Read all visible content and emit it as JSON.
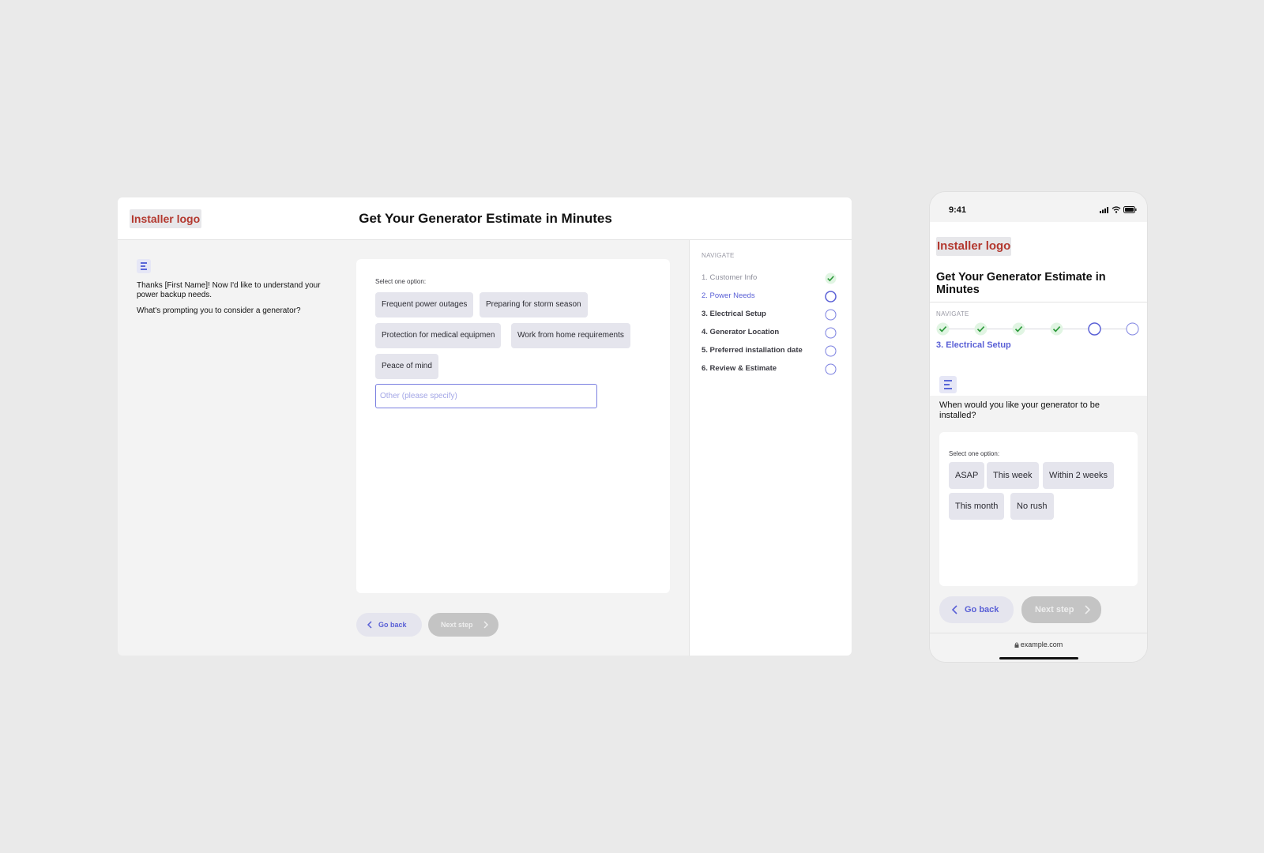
{
  "desktop": {
    "logo": "Installer logo",
    "title": "Get Your Generator Estimate in Minutes",
    "message": "Thanks [First Name]! Now I'd like to understand your power backup needs.",
    "question": "What's prompting you to consider a generator?",
    "select_label": "Select one option:",
    "options": [
      "Frequent power outages",
      "Preparing for storm season",
      "Protection for medical equipmen",
      "Work from home requirements",
      "Peace of mind"
    ],
    "other_placeholder": "Other (please specify)",
    "back_label": "Go back",
    "next_label": "Next step",
    "nav": {
      "heading": "NAVIGATE",
      "items": [
        {
          "label": "1. Customer Info",
          "status": "done"
        },
        {
          "label": "2. Power Needs",
          "status": "current"
        },
        {
          "label": "3. Electrical Setup",
          "status": "todo"
        },
        {
          "label": "4. Generator Location",
          "status": "todo"
        },
        {
          "label": "5. Preferred installation date",
          "status": "todo"
        },
        {
          "label": "6. Review & Estimate",
          "status": "todo"
        }
      ]
    }
  },
  "mobile": {
    "time": "9:41",
    "logo": "Installer logo",
    "title": "Get Your Generator Estimate in Minutes",
    "nav_heading": "NAVIGATE",
    "steps": [
      "done",
      "done",
      "done",
      "done",
      "current",
      "todo"
    ],
    "current_step_label": "3. Electrical Setup",
    "question": "When would you like your generator to be installed?",
    "select_label": "Select one option:",
    "options": [
      "ASAP",
      "This week",
      "Within 2 weeks",
      "This month",
      "No rush"
    ],
    "back_label": "Go back",
    "next_label": "Next step",
    "url": "example.com"
  },
  "colors": {
    "accent": "#5a60d6",
    "logo_text": "#b3382f",
    "done_bg": "#e1f5e3",
    "done_check": "#2e9a3c"
  },
  "icons": {
    "check": "check-icon",
    "back": "chevron-left-icon",
    "next": "chevron-right-icon",
    "lock": "lock-icon",
    "signal": "signal-icon",
    "wifi": "wifi-icon",
    "battery": "battery-icon"
  }
}
